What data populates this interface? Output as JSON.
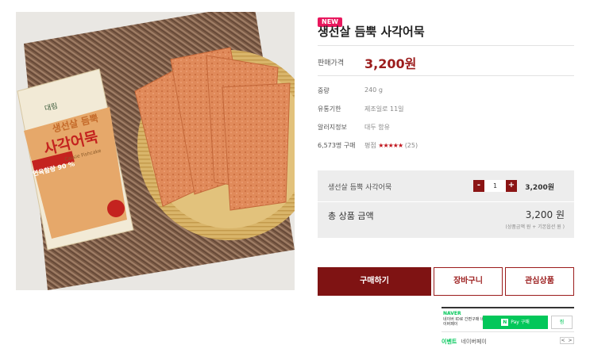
{
  "product": {
    "badge": "NEW",
    "title": "생선살 듬뿍 사각어묵",
    "price_label": "판매가격",
    "price": "3,200원",
    "image": {
      "package_brand": "대림",
      "package_title_1": "생선살 듬뿍",
      "package_title_2": "사각어묵",
      "package_sub": "Cassie Fishcake",
      "package_ribbon": "연육함량 90 %"
    }
  },
  "specs": [
    {
      "label": "중량",
      "value": "240 g"
    },
    {
      "label": "유통기한",
      "value": "제조일로 11일"
    },
    {
      "label": "알러지정보",
      "value": "대두 함유"
    }
  ],
  "rating": {
    "label": "6,573명 구매",
    "prefix": "평점",
    "stars": "★★★★★",
    "count": "(25)"
  },
  "option": {
    "name": "생선살 듬뿍 사각어묵",
    "minus": "-",
    "quantity": "1",
    "plus": "+",
    "price": "3,200원",
    "total_label": "총 상품 금액",
    "total_value": "3,200 원",
    "total_note": "(상품금액 원 + 기본옵션 원 )"
  },
  "buttons": {
    "buy": "구매하기",
    "cart": "장바구니",
    "wish": "관심상품"
  },
  "naver": {
    "logo": "NAVER",
    "desc": "네이버 ID로 간편구매 네이버페이",
    "pay_mark": "N",
    "pay_label": "Pay 구매",
    "zzim": "찜",
    "event_label": "이벤트",
    "event_value": "네이버페이",
    "pager": "< >"
  },
  "colors": {
    "accent": "#9b1c1c",
    "buy_button": "#7f1313",
    "badge": "#e8175d",
    "naver_green": "#03c75a",
    "stars": "#c0151d"
  }
}
